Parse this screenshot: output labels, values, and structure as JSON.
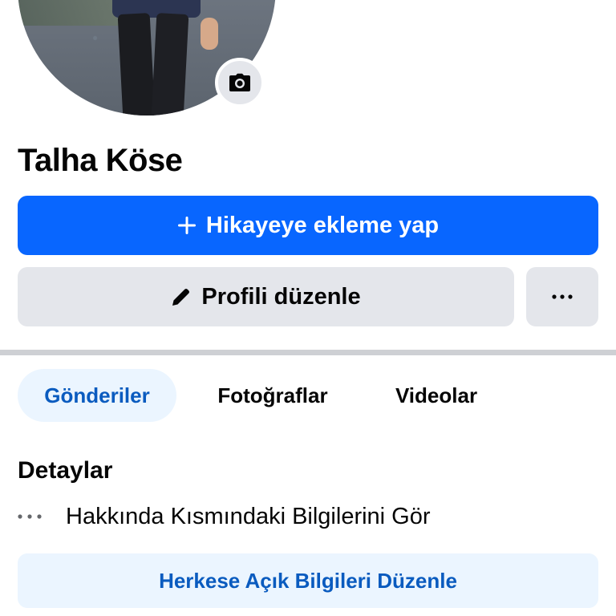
{
  "profile": {
    "name": "Talha Köse",
    "avatar_icon": "camera-icon"
  },
  "actions": {
    "add_story_label": "Hikayeye ekleme yap",
    "add_story_icon": "plus-icon",
    "edit_profile_label": "Profili düzenle",
    "edit_profile_icon": "pencil-icon",
    "more_icon": "more-horizontal-icon"
  },
  "tabs": [
    {
      "label": "Gönderiler",
      "active": true
    },
    {
      "label": "Fotoğraflar",
      "active": false
    },
    {
      "label": "Videolar",
      "active": false
    }
  ],
  "details": {
    "title": "Detaylar",
    "about_link": "Hakkında Kısmındaki Bilgilerini Gör",
    "edit_public_label": "Herkese Açık Bilgileri Düzenle"
  },
  "colors": {
    "primary": "#0866ff",
    "secondary_bg": "#e4e6eb",
    "active_tab_bg": "#ebf5ff",
    "active_tab_text": "#0a5bbf",
    "divider": "#ced0d4"
  }
}
